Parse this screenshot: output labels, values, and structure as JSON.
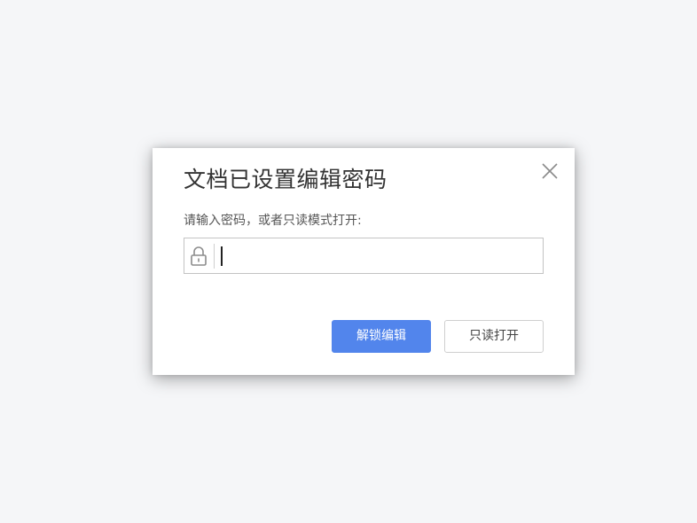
{
  "dialog": {
    "title": "文档已设置编辑密码",
    "prompt": "请输入密码，或者只读模式打开:",
    "password_field": {
      "value": "",
      "placeholder": ""
    },
    "buttons": {
      "unlock_label": "解锁编辑",
      "readonly_label": "只读打开"
    }
  },
  "icons": {
    "close": "close-icon",
    "lock": "lock-icon"
  },
  "colors": {
    "primary": "#5285ec",
    "background": "#f5f6f8"
  }
}
